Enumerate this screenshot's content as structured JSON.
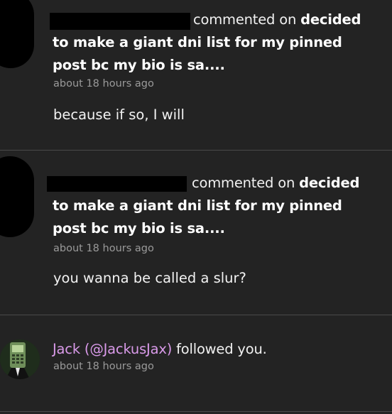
{
  "notifications": [
    {
      "type": "comment",
      "action_text": "commented on",
      "post_title": "decided to make a giant dni list for my pinned post bc my bio is sa....",
      "post_line1": "decided",
      "post_line2": "to make a giant dni list for my pinned",
      "post_line3": "post bc my bio is sa....",
      "time": "about 18 hours ago",
      "comment": "because if so, I will"
    },
    {
      "type": "comment",
      "action_text": "commented on",
      "post_line1": "decided",
      "post_line2": "to make a giant dni list for my pinned",
      "post_line3": "post bc my bio is sa....",
      "time": "about 18 hours ago",
      "comment": "you wanna be called a slur?"
    },
    {
      "type": "follow",
      "user_display": "Jack (@JackusJax)",
      "action_text": "followed you.",
      "time": "about 18 hours ago"
    }
  ],
  "colors": {
    "background": "#232323",
    "divider": "#4a4a4a",
    "link": "#d99ae9",
    "timestamp": "#9a9a9a"
  },
  "icons": {
    "follower_avatar": "phone-avatar-icon"
  }
}
